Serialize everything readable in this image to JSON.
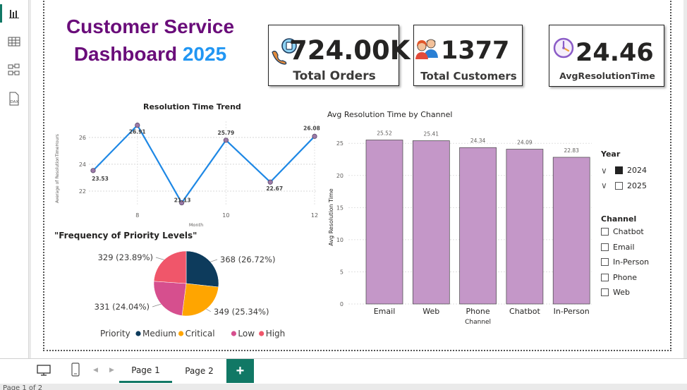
{
  "dashboard": {
    "title_line1": "Customer Service",
    "title_line2": "Dashboard",
    "title_year": "2025"
  },
  "kpis": [
    {
      "value": "724.00K",
      "label": "Total Orders",
      "icon": "phone-headset-icon"
    },
    {
      "value": "1377",
      "label": "Total  Customers",
      "icon": "customers-icon"
    },
    {
      "value": "24.46",
      "label": "AvgResolutionTime",
      "icon": "clock-icon"
    }
  ],
  "colors": {
    "title_purple": "#6a0d7a",
    "title_blue": "#2196f3",
    "line": "#1e88e5",
    "bar": "#c497c8",
    "accent": "#117865",
    "medium": "#0d3b5c",
    "critical": "#ffa500",
    "low": "#d64f8e",
    "high": "#f0566a"
  },
  "chart_data": [
    {
      "type": "line",
      "title": "Resolution Time Trend",
      "xlabel": "Month",
      "ylabel": "Average of ResolutionTimeHours",
      "x": [
        7,
        8,
        9,
        10,
        11,
        12
      ],
      "x_ticks": [
        "8",
        "10",
        "12"
      ],
      "y_ticks": [
        "22",
        "24",
        "26"
      ],
      "values": [
        23.53,
        26.91,
        21.13,
        25.79,
        22.67,
        26.08
      ],
      "labels": [
        "23.53",
        "26.91",
        "21.13",
        "25.79",
        "22.67",
        "26.08"
      ],
      "ylim": [
        21,
        27.2
      ],
      "xlim": [
        7,
        12
      ],
      "grid": true
    },
    {
      "type": "pie",
      "title": "\"Frequency of Priority Levels\"",
      "legend_title": "Priority",
      "categories": [
        "Medium",
        "Critical",
        "Low",
        "High"
      ],
      "values": [
        368,
        349,
        331,
        329
      ],
      "labels": [
        "368 (26.72%)",
        "349 (25.34%)",
        "331 (24.04%)",
        "329 (23.89%)"
      ],
      "legend_position": "bottom"
    },
    {
      "type": "bar",
      "title": "Avg Resolution Time by Channel",
      "xlabel": "Channel",
      "ylabel": "Avg Resolution Time",
      "categories": [
        "Email",
        "Web",
        "Phone",
        "Chatbot",
        "In-Person"
      ],
      "values": [
        25.52,
        25.41,
        24.34,
        24.09,
        22.83
      ],
      "labels": [
        "25.52",
        "25.41",
        "24.34",
        "24.09",
        "22.83"
      ],
      "y_ticks": [
        "0",
        "5",
        "10",
        "15",
        "20",
        "25"
      ],
      "ylim": [
        0,
        27
      ],
      "grid": true
    }
  ],
  "slicers": {
    "year": {
      "title": "Year",
      "items": [
        {
          "label": "2024",
          "checked": true
        },
        {
          "label": "2025",
          "checked": false
        }
      ]
    },
    "channel": {
      "title": "Channel",
      "items": [
        "Chatbot",
        "Email",
        "In-Person",
        "Phone",
        "Web"
      ]
    }
  },
  "pages": {
    "tabs": [
      "Page 1",
      "Page 2"
    ],
    "add": "+",
    "status": "Page 1 of 2"
  }
}
